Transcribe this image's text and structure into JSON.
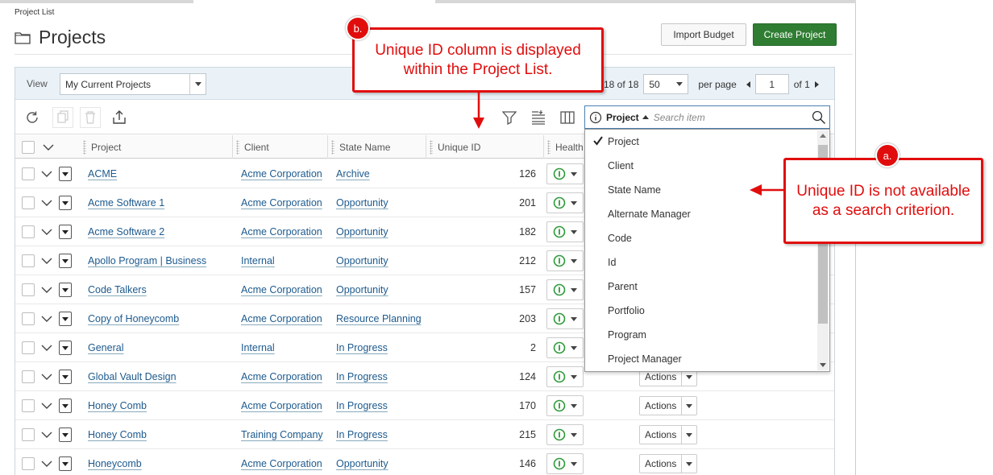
{
  "breadcrumb": "Project List",
  "page_title": "Projects",
  "buttons": {
    "import_budget": "Import Budget",
    "create_project": "Create Project"
  },
  "view_bar": {
    "view_label": "View",
    "view_value": "My Current Projects",
    "count_prefix": "18 of 18",
    "page_size": "50",
    "per_page_label": "per page",
    "page_number": "1",
    "page_total": "of 1"
  },
  "columns": {
    "project": "Project",
    "client": "Client",
    "state_name": "State Name",
    "unique_id": "Unique ID",
    "health": "Health"
  },
  "rows": [
    {
      "project": "ACME",
      "client": "Acme Corporation",
      "state": "Archive",
      "uid": "126",
      "actions": ""
    },
    {
      "project": "Acme Software 1",
      "client": "Acme Corporation",
      "state": "Opportunity",
      "uid": "201",
      "actions": ""
    },
    {
      "project": "Acme Software 2",
      "client": "Acme Corporation",
      "state": "Opportunity",
      "uid": "182",
      "actions": ""
    },
    {
      "project": "Apollo Program | Business",
      "client": "Internal",
      "state": "Opportunity",
      "uid": "212",
      "actions": ""
    },
    {
      "project": "Code Talkers",
      "client": "Acme Corporation",
      "state": "Opportunity",
      "uid": "157",
      "actions": ""
    },
    {
      "project": "Copy of Honeycomb",
      "client": "Acme Corporation",
      "state": "Resource Planning",
      "uid": "203",
      "actions": ""
    },
    {
      "project": "General",
      "client": "Internal",
      "state": "In Progress",
      "uid": "2",
      "actions": ""
    },
    {
      "project": "Global Vault Design",
      "client": "Acme Corporation",
      "state": "In Progress",
      "uid": "124",
      "actions": "Actions"
    },
    {
      "project": "Honey Comb",
      "client": "Acme Corporation",
      "state": "In Progress",
      "uid": "170",
      "actions": "Actions"
    },
    {
      "project": "Honey Comb",
      "client": "Training Company",
      "state": "In Progress",
      "uid": "215",
      "actions": "Actions"
    },
    {
      "project": "Honeycomb",
      "client": "Acme Corporation",
      "state": "Opportunity",
      "uid": "146",
      "actions": "Actions"
    }
  ],
  "search": {
    "field": "Project",
    "placeholder": "Search item",
    "options": [
      "Project",
      "Client",
      "State Name",
      "Alternate Manager",
      "Code",
      "Id",
      "Parent",
      "Portfolio",
      "Program",
      "Project Manager"
    ],
    "selected": "Project"
  },
  "callouts": {
    "b_badge": "b.",
    "b_text": "Unique ID column is displayed within the Project List.",
    "a_badge": "a.",
    "a_text": "Unique ID is not available as a search criterion."
  },
  "colors": {
    "accent_red": "#e10d0d",
    "create_green": "#2f7d32",
    "link_blue": "#1d5a8e",
    "health_green": "#2e9a3a"
  },
  "icons": [
    "folder-icon",
    "refresh-icon",
    "copy-icon",
    "delete-icon",
    "export-icon",
    "filter-icon",
    "group-icon",
    "columns-icon",
    "info-icon",
    "search-icon",
    "health-indicator-icon",
    "checkmark-icon"
  ]
}
